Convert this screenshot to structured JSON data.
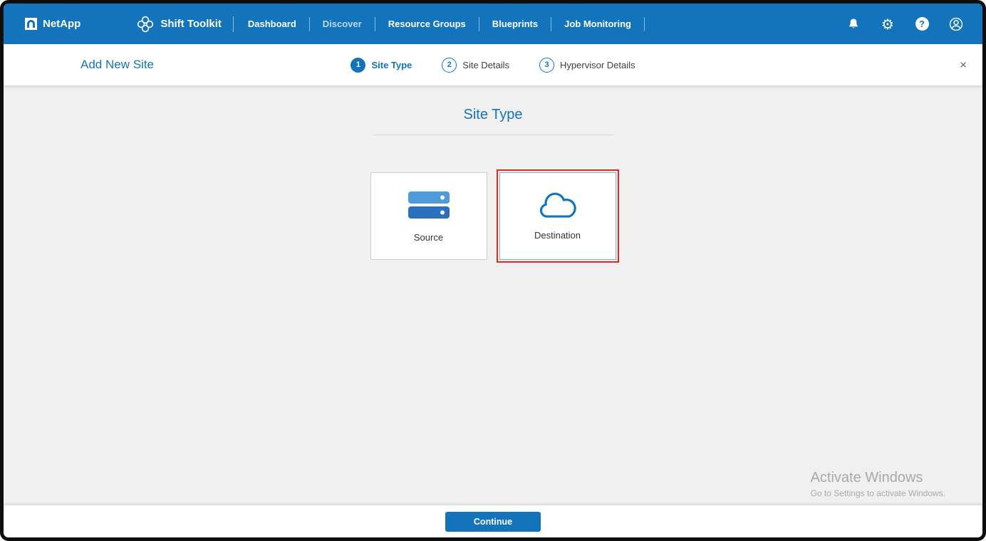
{
  "header": {
    "brand": "NetApp",
    "app_name": "Shift Toolkit",
    "nav": [
      {
        "label": "Dashboard"
      },
      {
        "label": "Discover"
      },
      {
        "label": "Resource Groups"
      },
      {
        "label": "Blueprints"
      },
      {
        "label": "Job Monitoring"
      }
    ]
  },
  "icons": {
    "gear": "⚙",
    "close": "×"
  },
  "wizard": {
    "title": "Add New Site",
    "steps": [
      {
        "number": "1",
        "label": "Site Type"
      },
      {
        "number": "2",
        "label": "Site Details"
      },
      {
        "number": "3",
        "label": "Hypervisor Details"
      }
    ]
  },
  "main": {
    "heading": "Site Type",
    "cards": [
      {
        "label": "Source",
        "selected": false
      },
      {
        "label": "Destination",
        "selected": true
      }
    ]
  },
  "watermark": {
    "line1": "Activate Windows",
    "line2": "Go to Settings to activate Windows."
  },
  "footer": {
    "continue_label": "Continue"
  },
  "colors": {
    "header_bg": "#1374bc",
    "accent": "#1374bc",
    "selected_outline": "#e02b20"
  }
}
